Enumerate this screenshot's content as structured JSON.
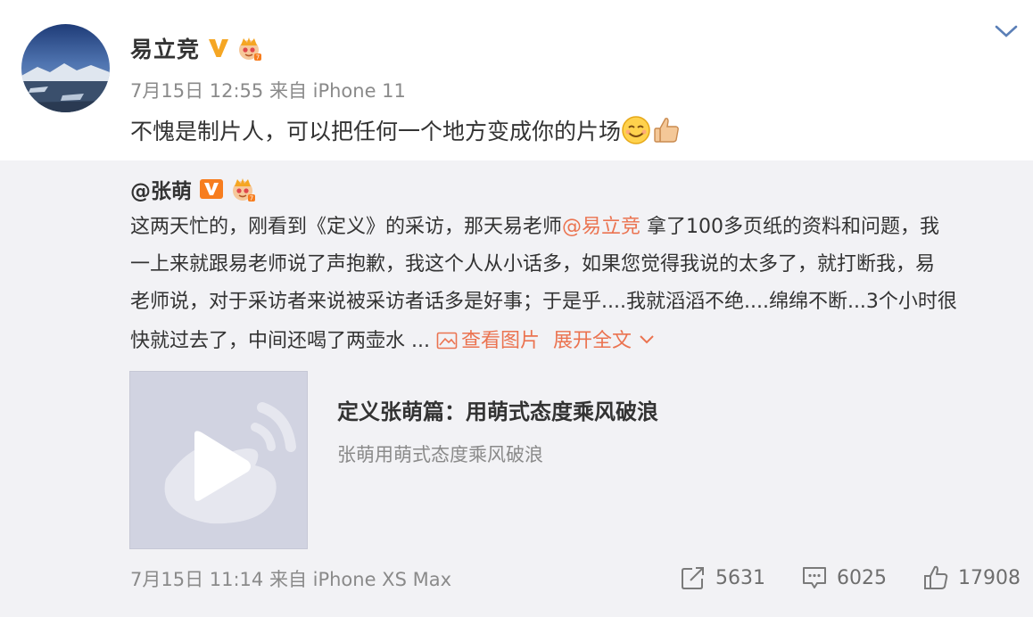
{
  "post": {
    "author": "易立竞",
    "meta": "7月15日 12:55 来自 iPhone 11",
    "text": "不愧是制片人，可以把任何一个地方变成你的片场"
  },
  "repost": {
    "author": "@张萌",
    "line1_pre": "这两天忙的，刚看到《定义》的采访，那天易老师",
    "mention": "@易立竞",
    "line1_post": " 拿了100多页纸的资料和问题，我",
    "line2": "一上来就跟易老师说了声抱歉，我这个人从小话多，如果您觉得我说的太多了，就打断我，易",
    "line3": "老师说，对于采访者来说被采访者话多是好事；于是乎....我就滔滔不绝....绵绵不断...3个小时很",
    "line4": "快就过去了，中间还喝了两壶水 ...",
    "view_images": "查看图片",
    "expand": "展开全文",
    "card_title": "定义张萌篇：用萌式态度乘风破浪",
    "card_subtitle": "张萌用萌式态度乘风破浪",
    "meta": "7月15日 11:14 来自 iPhone XS Max",
    "reposts": "5631",
    "comments": "6025",
    "likes": "17908"
  },
  "colors": {
    "accent": "#eb7350",
    "verified_gold": "#f5a623",
    "verified_orange": "#f77d1e",
    "repost_bg": "#f2f2f5",
    "chevron": "#5b7fb7"
  },
  "icons": [
    "chevron-down-icon",
    "verified-v-icon",
    "crown-badge-icon",
    "smile-emoji-icon",
    "thumbs-up-emoji-icon",
    "image-icon",
    "weibo-play-icon",
    "repost-icon",
    "comment-icon",
    "like-icon"
  ]
}
